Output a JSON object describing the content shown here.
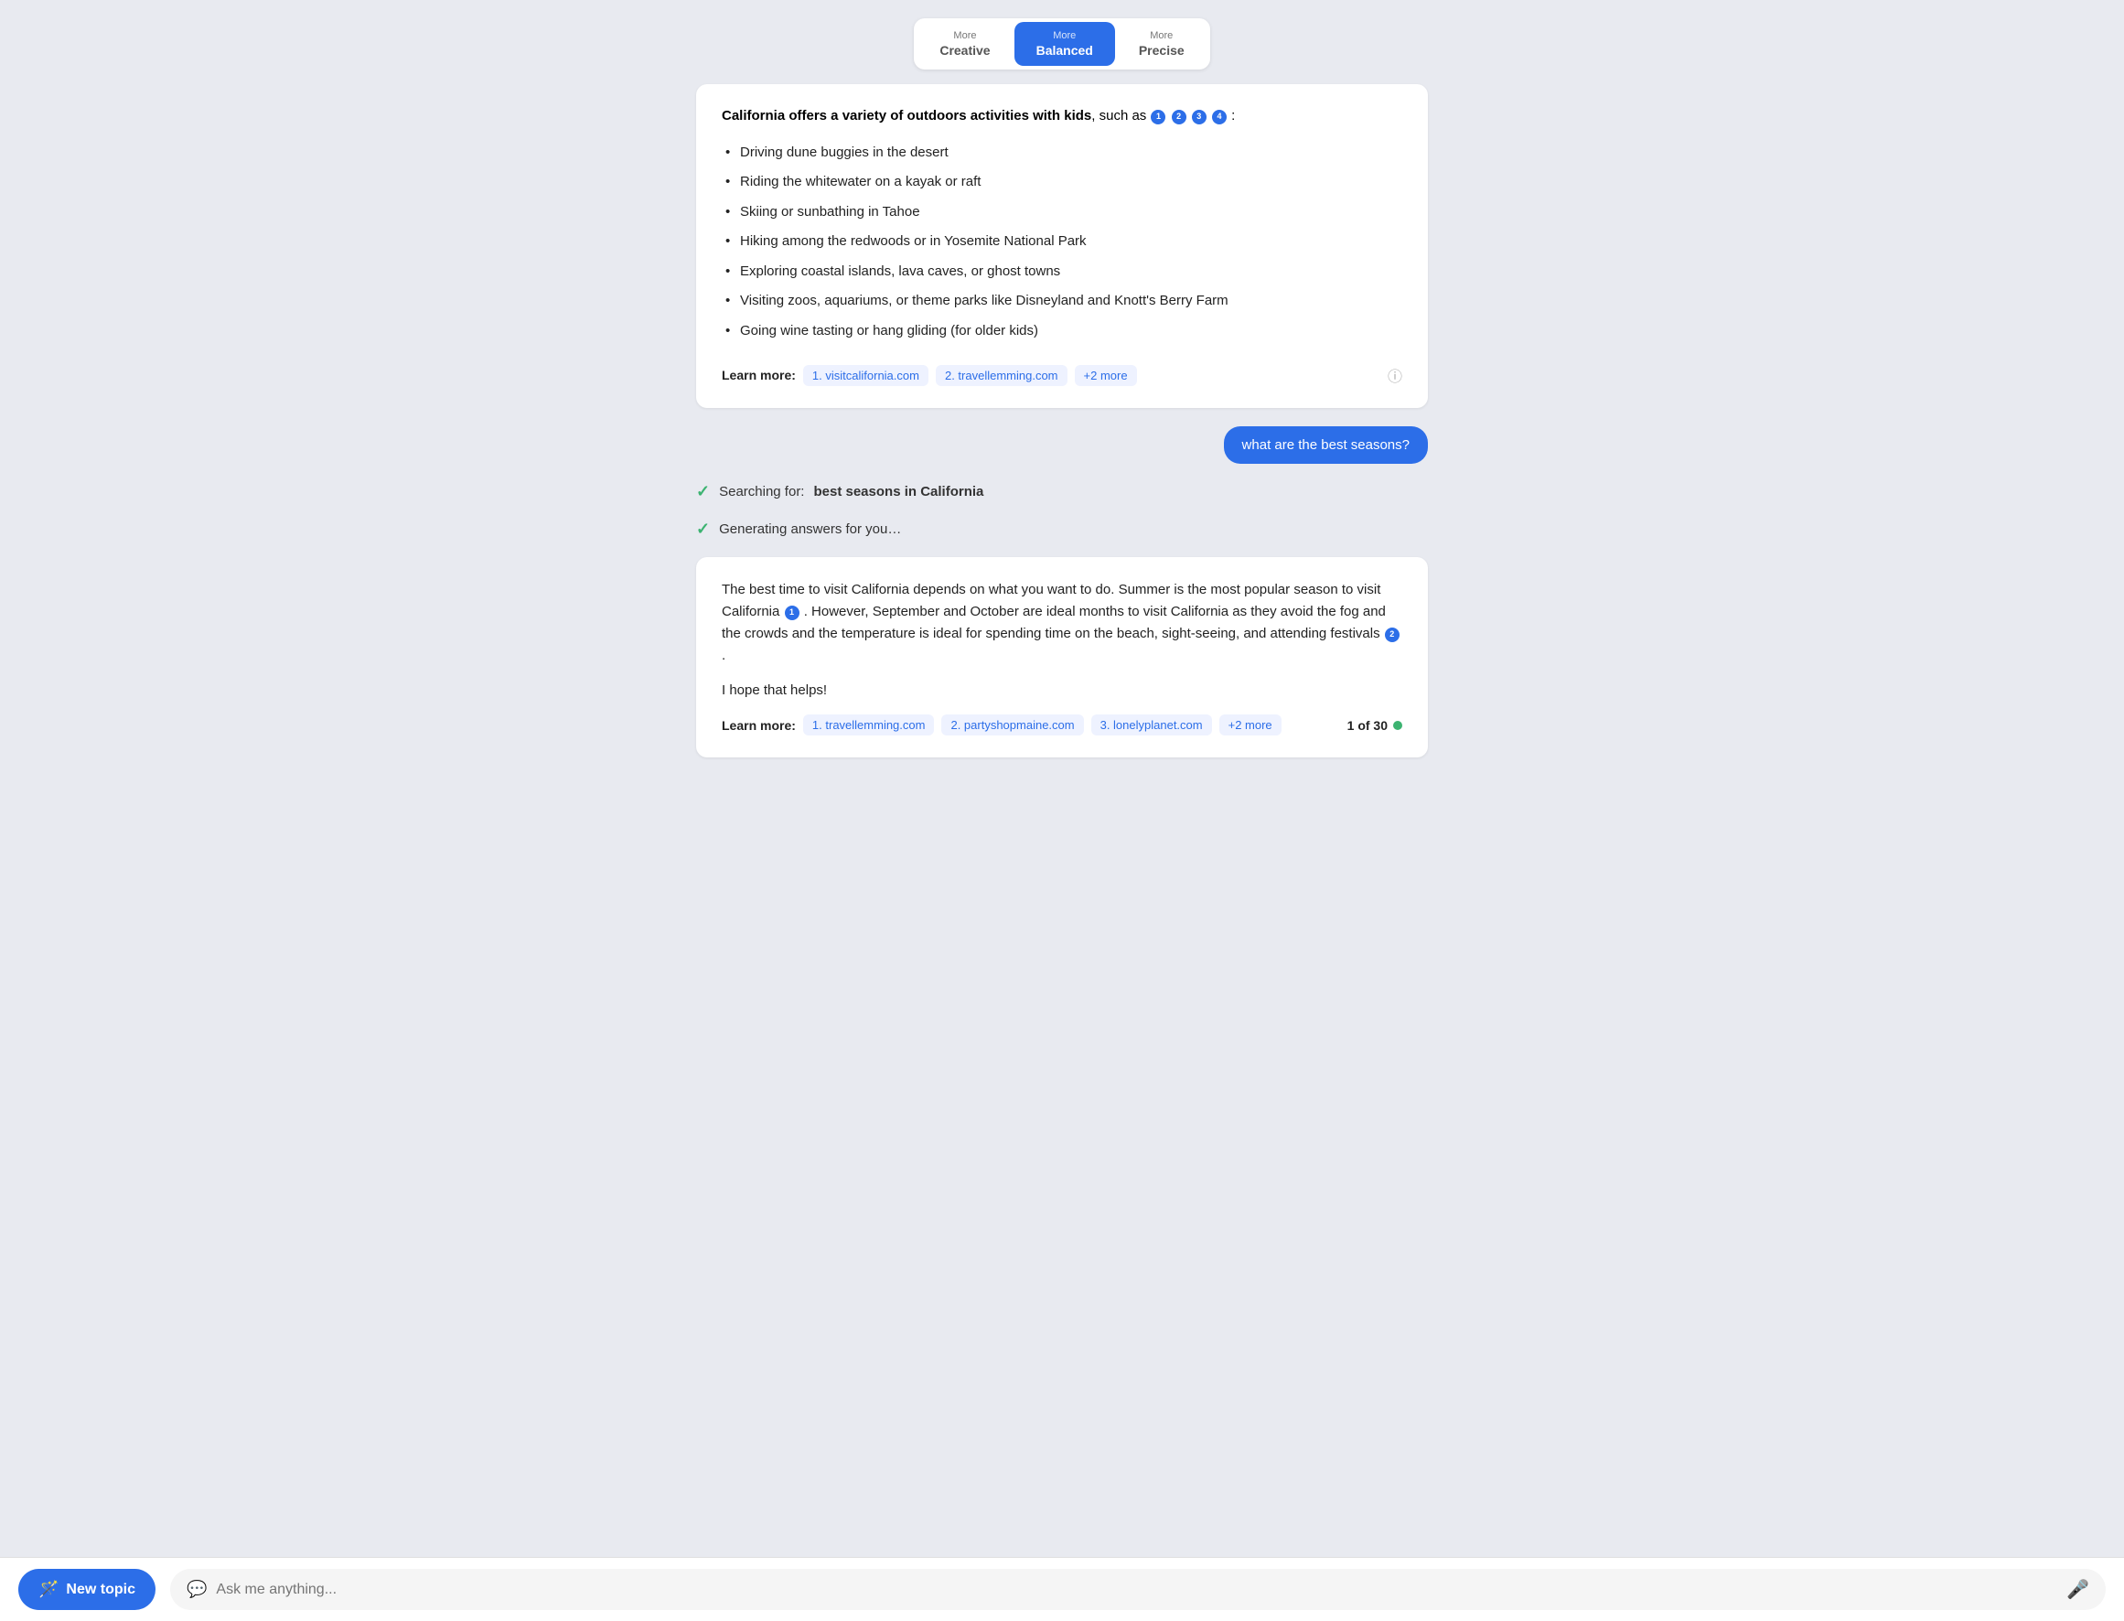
{
  "mode_selector": {
    "buttons": [
      {
        "id": "creative",
        "top": "More",
        "main": "Creative",
        "active": false
      },
      {
        "id": "balanced",
        "top": "More",
        "main": "Balanced",
        "active": true
      },
      {
        "id": "precise",
        "top": "More",
        "main": "Precise",
        "active": false
      }
    ]
  },
  "card1": {
    "intro_bold": "California offers a variety of outdoors activities with kids",
    "intro_suffix": ", such as",
    "refs": [
      "1",
      "2",
      "3",
      "4"
    ],
    "colon": " :",
    "bullets": [
      "Driving dune buggies in the desert",
      "Riding the whitewater on a kayak or raft",
      "Skiing or sunbathing in Tahoe",
      "Hiking among the redwoods or in Yosemite National Park",
      "Exploring coastal islands, lava caves, or ghost towns",
      "Visiting zoos, aquariums, or theme parks like Disneyland and Knott's Berry Farm",
      "Going wine tasting or hang gliding (for older kids)"
    ],
    "learn_more_label": "Learn more:",
    "links": [
      "1. visitcalifornia.com",
      "2. travellemming.com",
      "+2 more"
    ]
  },
  "user_message": {
    "text": "what are the best seasons?"
  },
  "status": {
    "line1_prefix": "Searching for: ",
    "line1_bold": "best seasons in California",
    "line2": "Generating answers for you…"
  },
  "card2": {
    "paragraph1_parts": [
      "The best time to visit California depends on what you want to do. Summer is the most popular season to visit California",
      " . However, September and October are ideal months to visit California as they avoid the fog and the crowds and the temperature is ideal for spending time on the beach, sight-seeing, and attending festivals",
      " ."
    ],
    "ref1": "1",
    "ref2": "2",
    "paragraph2": "I hope that helps!",
    "learn_more_label": "Learn more:",
    "links": [
      "1. travellemming.com",
      "2. partyshopmaine.com",
      "3. lonelyplanet.com",
      "+2 more"
    ],
    "page_count": "1 of 30"
  },
  "bottom_bar": {
    "new_topic_label": "New topic",
    "input_placeholder": "Ask me anything..."
  }
}
